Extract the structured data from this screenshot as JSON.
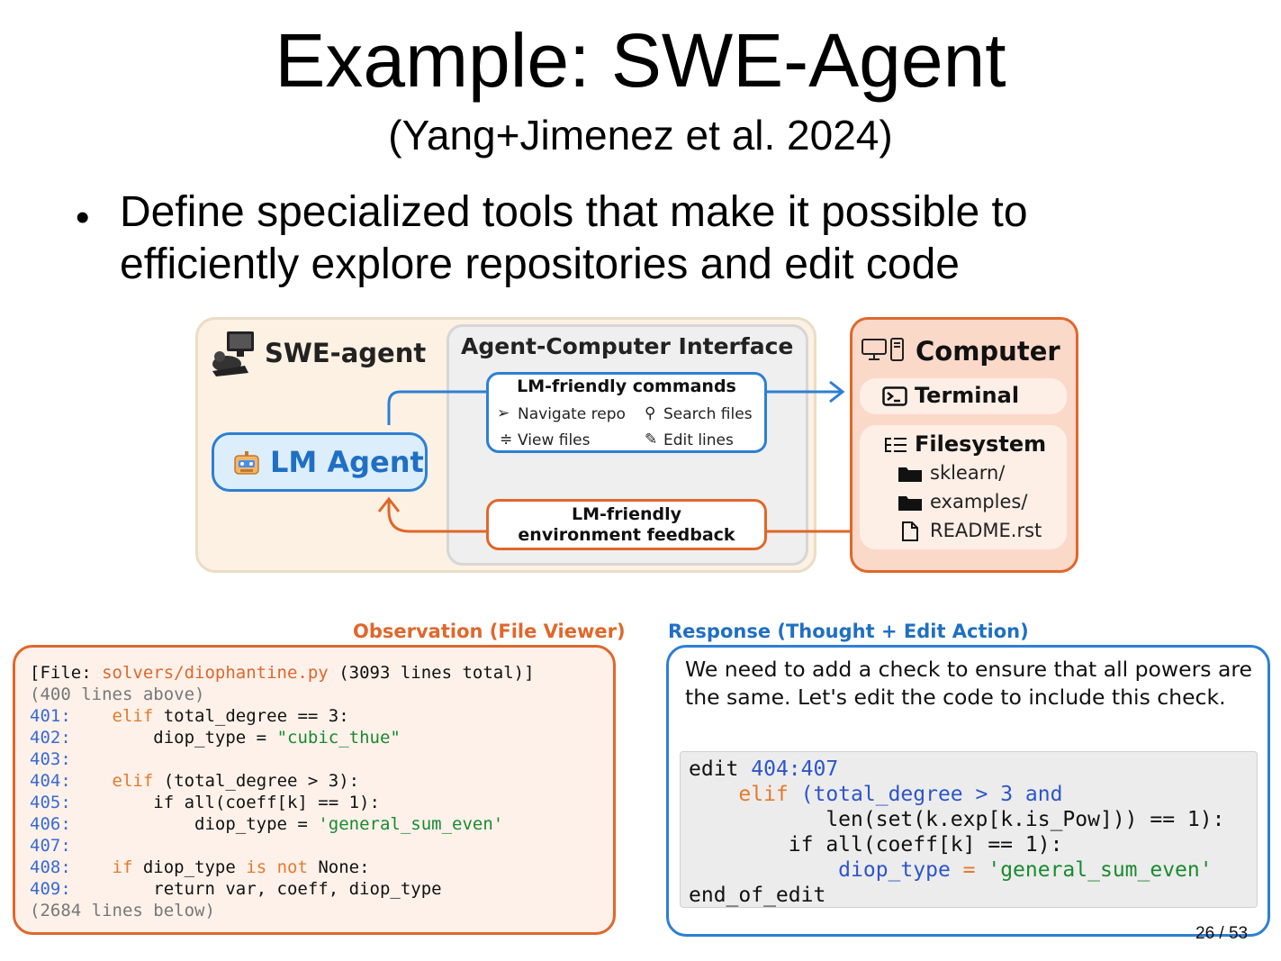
{
  "slide": {
    "title": "Example: SWE-Agent",
    "subtitle": "(Yang+Jimenez et al. 2024)",
    "bullet": "Define specialized tools that make it possible to efficiently explore repositories and edit code",
    "bullet_line1": "Define specialized tools that make it possible to",
    "bullet_line2": "efficiently explore repositories and edit code",
    "page_number": "26 / 53"
  },
  "diagram": {
    "swe_agent_label": "SWE-agent",
    "aci_title": "Agent-Computer Interface",
    "lm_agent_label": "LM Agent",
    "commands": {
      "title": "LM-friendly commands",
      "items": [
        "Navigate repo",
        "Search files",
        "View files",
        "Edit lines"
      ]
    },
    "feedback": {
      "line1": "LM-friendly",
      "line2": "environment feedback"
    },
    "computer": {
      "title": "Computer",
      "terminal": "Terminal",
      "filesystem": "Filesystem",
      "files": [
        "sklearn/",
        "examples/",
        "README.rst"
      ]
    },
    "colors": {
      "blue": "#2d7fd4",
      "orange": "#e0672b",
      "swe_bg": "#fcf1e2",
      "computer_bg": "#fbd9c9"
    }
  },
  "observation": {
    "label": "Observation (File Viewer)",
    "header_prefix": "[File: ",
    "file_path": "solvers/diophantine.py",
    "header_suffix": " (3093 lines total)]",
    "above": "(400 lines above)",
    "below": "(2684 lines below)",
    "line_numbers": [
      "401:",
      "402:",
      "403:",
      "404:",
      "405:",
      "406:",
      "407:",
      "408:",
      "409:"
    ],
    "tokens": {
      "elif": "elif",
      "total_degree_eq3": " total_degree == 3:",
      "diop_type_assign": "diop_type = ",
      "cubic_thue": "\"cubic_thue\"",
      "elif_paren": "(total_degree > 3):",
      "if_all": "if all(coeff[k] == 1):",
      "general_sum_even": "'general_sum_even'",
      "if": "if",
      "diop_type": " diop_type ",
      "is_not": "is not",
      "none": " None:",
      "return_stmt": "return var, coeff, diop_type"
    }
  },
  "response": {
    "label": "Response (Thought + Edit Action)",
    "thought": "We need to add a check to ensure that all powers are the same. Let's edit the code to include this check.",
    "edit_cmd": "edit",
    "edit_range": "404:407",
    "line1_kw": "elif",
    "line1_rest": "(total_degree > 3 and",
    "line2": "len(set(k.exp[k.is_Pow])) == 1):",
    "line3": "if all(coeff[k] == 1):",
    "line4_var": "diop_type",
    "line4_eq": " = ",
    "line4_str": "'general_sum_even'",
    "end": "end_of_edit"
  }
}
